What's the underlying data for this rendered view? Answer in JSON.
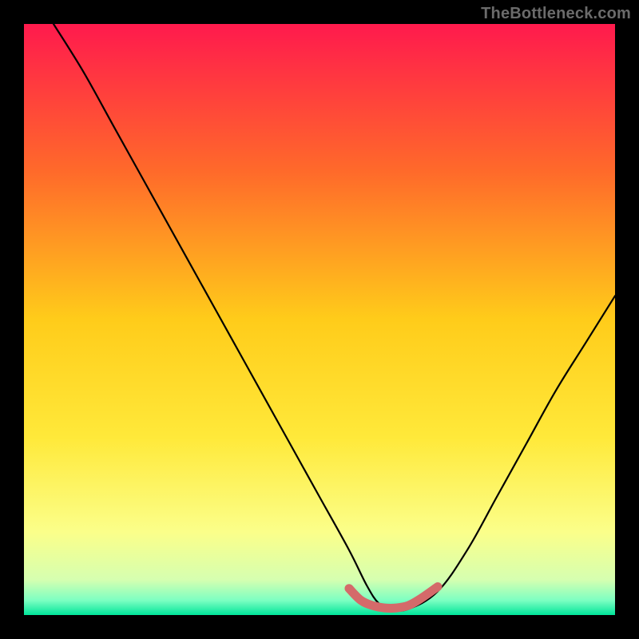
{
  "watermark": "TheBottleneck.com",
  "colors": {
    "frame": "#000000",
    "curve": "#000000",
    "marker": "#d46a6a",
    "gradient_stops": [
      {
        "offset": 0.0,
        "color": "#ff1a4d"
      },
      {
        "offset": 0.25,
        "color": "#ff6a2a"
      },
      {
        "offset": 0.5,
        "color": "#ffcc1a"
      },
      {
        "offset": 0.7,
        "color": "#ffe93a"
      },
      {
        "offset": 0.86,
        "color": "#fbff8a"
      },
      {
        "offset": 0.94,
        "color": "#d6ffb0"
      },
      {
        "offset": 0.975,
        "color": "#7dffc2"
      },
      {
        "offset": 1.0,
        "color": "#00e59a"
      }
    ]
  },
  "chart_data": {
    "type": "line",
    "title": "",
    "xlabel": "",
    "ylabel": "",
    "xlim": [
      0,
      100
    ],
    "ylim": [
      0,
      100
    ],
    "series": [
      {
        "name": "bottleneck-curve",
        "x": [
          5,
          10,
          15,
          20,
          25,
          30,
          35,
          40,
          45,
          50,
          55,
          58,
          60,
          62,
          65,
          70,
          75,
          80,
          85,
          90,
          95,
          100
        ],
        "y": [
          100,
          92,
          83,
          74,
          65,
          56,
          47,
          38,
          29,
          20,
          11,
          5,
          2,
          1,
          1,
          4,
          11,
          20,
          29,
          38,
          46,
          54
        ]
      },
      {
        "name": "optimal-range-marker",
        "x": [
          55,
          57,
          59,
          61,
          63,
          65,
          67,
          70
        ],
        "y": [
          4.5,
          2.5,
          1.6,
          1.2,
          1.2,
          1.6,
          2.7,
          4.8
        ]
      }
    ],
    "annotations": []
  }
}
